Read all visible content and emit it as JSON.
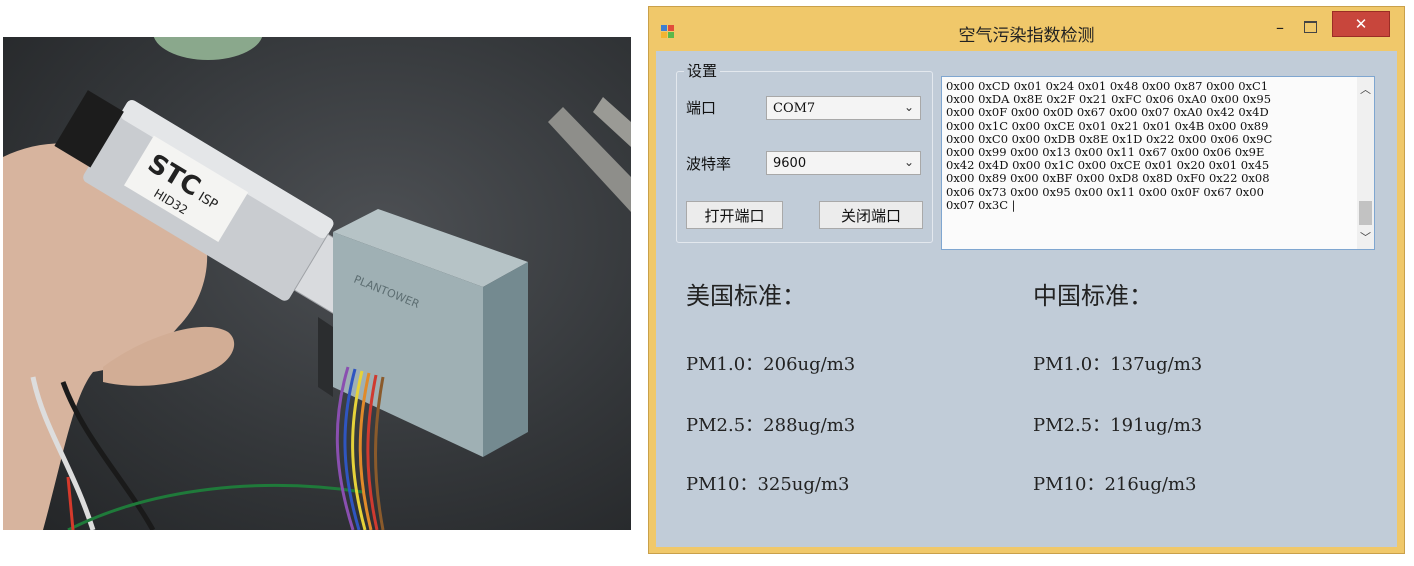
{
  "window": {
    "title": "空气污染指数检测",
    "minimize_glyph": "–",
    "close_glyph": "✕"
  },
  "settings": {
    "group_title": "设置",
    "port_label": "端口",
    "port_value": "COM7",
    "baud_label": "波特率",
    "baud_value": "9600",
    "open_button": "打开端口",
    "close_button": "关闭端口"
  },
  "serial_log": "0x00 0xCD 0x01 0x24 0x01 0x48 0x00 0x87 0x00 0xC1\n0x00 0xDA 0x8E 0x2F 0x21 0xFC 0x06 0xA0 0x00 0x95\n0x00 0x0F 0x00 0x0D 0x67 0x00 0x07 0xA0 0x42 0x4D\n0x00 0x1C 0x00 0xCE 0x01 0x21 0x01 0x4B 0x00 0x89\n0x00 0xC0 0x00 0xDB 0x8E 0x1D 0x22 0x00 0x06 0x9C\n0x00 0x99 0x00 0x13 0x00 0x11 0x67 0x00 0x06 0x9E\n0x42 0x4D 0x00 0x1C 0x00 0xCE 0x01 0x20 0x01 0x45\n0x00 0x89 0x00 0xBF 0x00 0xD8 0x8D 0xF0 0x22 0x08\n0x06 0x73 0x00 0x95 0x00 0x11 0x00 0x0F 0x67 0x00\n0x07 0x3C |",
  "us_standard": {
    "heading": "美国标准：",
    "pm1_0": "PM1.0：206ug/m3",
    "pm2_5": "PM2.5：288ug/m3",
    "pm10": "PM10：325ug/m3"
  },
  "cn_standard": {
    "heading": "中国标准：",
    "pm1_0": "PM1.0：137ug/m3",
    "pm2_5": "PM2.5：191ug/m3",
    "pm10": "PM10：216ug/m3"
  },
  "photo": {
    "dongle_brand": "STC",
    "dongle_sub": "ISP",
    "dongle_model": "HID32",
    "sensor_brand": "PLANTOWER"
  },
  "colors": {
    "window_frame": "#f0c86a",
    "client_bg": "#c1ccd8",
    "close_button": "#c8463c",
    "textbox_border": "#7fa6d0"
  },
  "icons": [
    "app-icon",
    "minimize-icon",
    "maximize-icon",
    "close-icon",
    "chevron-down-icon",
    "scroll-up-icon",
    "scroll-down-icon"
  ]
}
